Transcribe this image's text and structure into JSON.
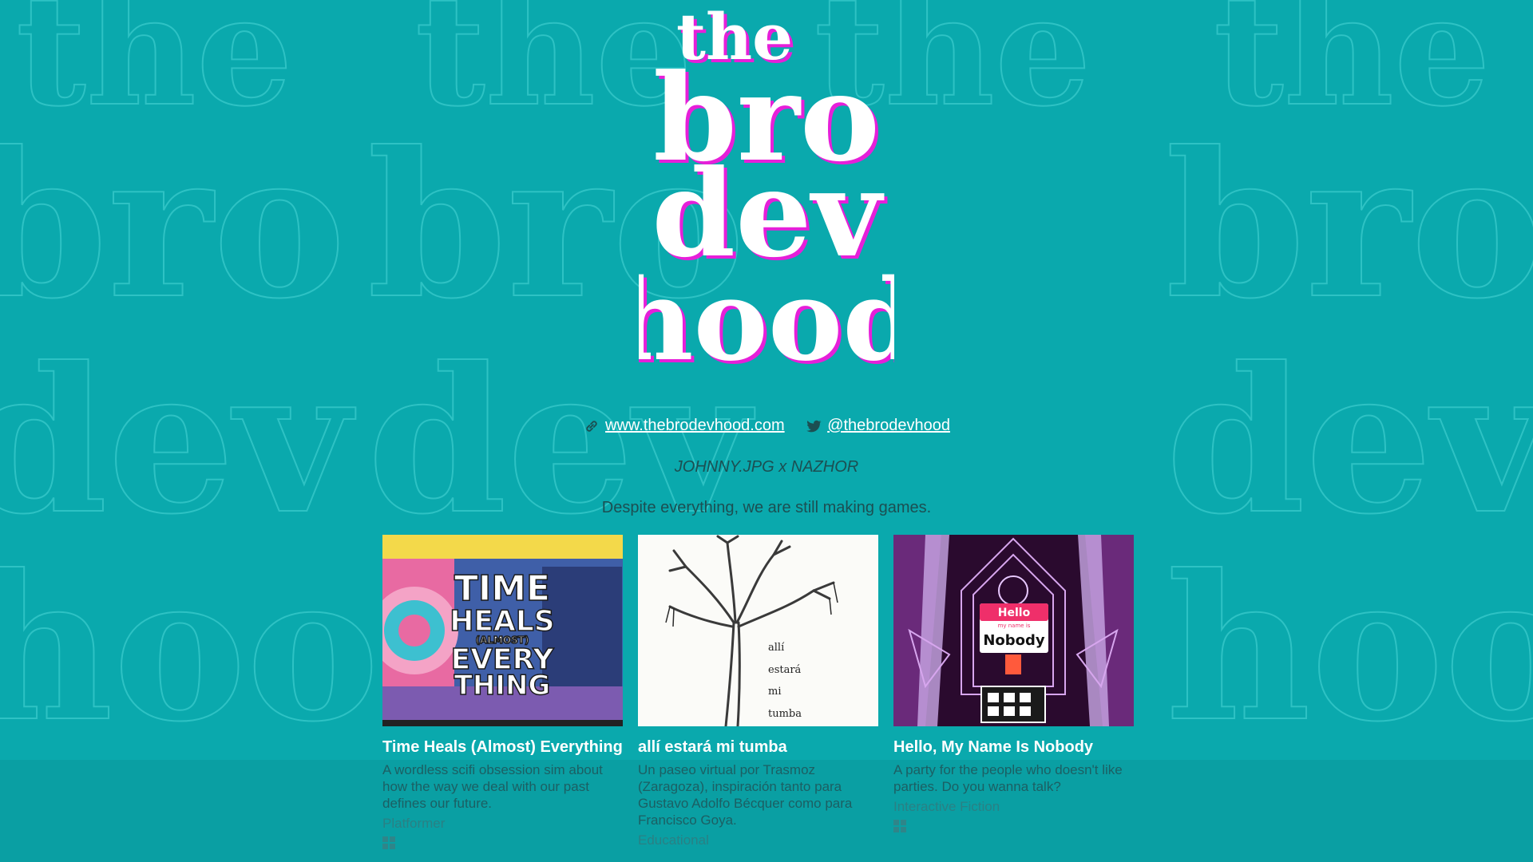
{
  "logo": {
    "lines": [
      "the",
      "bro",
      "dev",
      "hood"
    ]
  },
  "background": {
    "pattern_words": [
      "the",
      "bro",
      "dev",
      "hood"
    ]
  },
  "links": {
    "website": "www.thebrodevhood.com",
    "twitter": "@thebrodevhood"
  },
  "credits": "JOHNNY.JPG x NAZHOR",
  "tagline": "Despite everything, we are still making games.",
  "games": [
    {
      "title": "Time Heals (Almost) Everything",
      "description": "A wordless scifi obsession sim about how the way we deal with our past defines our future.",
      "genre": "Platformer",
      "cover_lines": [
        "TIME",
        "HEALS",
        "(ALMOST)",
        "EVERY",
        "THING"
      ],
      "platform_icon": "windows-icon"
    },
    {
      "title": "allí estará mi tumba",
      "description": "Un paseo virtual por Trasmoz (Zaragoza), inspiración tanto para Gustavo Adolfo Bécquer como para Francisco Goya.",
      "genre": "Educational",
      "cover_lines": [
        "allí",
        "estará",
        "mi",
        "tumba"
      ]
    },
    {
      "title": "Hello, My Name Is Nobody",
      "description": "A party for the people who doesn't like parties. Do you wanna talk?",
      "genre": "Interactive Fiction",
      "cover_lines": [
        "Hello",
        "my name is",
        "Nobody"
      ],
      "platform_icon": "windows-icon"
    }
  ],
  "colors": {
    "background": "#0aa9ad",
    "accent_pink": "#e61fd9",
    "text_dark": "#1c4f52",
    "link": "#ffffff"
  }
}
